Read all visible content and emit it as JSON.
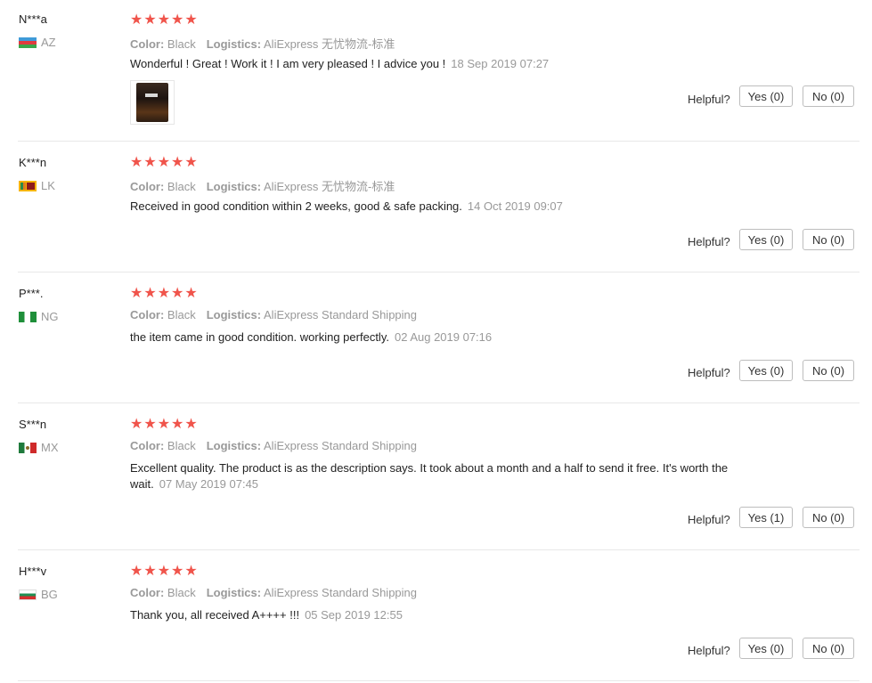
{
  "colors": {
    "star": "#f0544b",
    "muted": "#999999",
    "text": "#222222"
  },
  "labels": {
    "color": "Color:",
    "logistics": "Logistics:",
    "helpful": "Helpful?"
  },
  "reviews": [
    {
      "user": "N***a",
      "country": "AZ",
      "flag": "az-flag-icon",
      "stars": "★★★★★",
      "color": "Black",
      "logistics": "AliExpress 无忧物流-标准",
      "text": "Wonderful ! Great ! Work it ! I am very pleased ! I advice you !",
      "date": "18 Sep 2019 07:27",
      "yes": "Yes (0)",
      "no": "No (0)",
      "has_photo": true
    },
    {
      "user": "K***n",
      "country": "LK",
      "flag": "lk-flag-icon",
      "stars": "★★★★★",
      "color": "Black",
      "logistics": "AliExpress 无忧物流-标准",
      "text": "Received in good condition within 2 weeks, good & safe packing.",
      "date": "14 Oct 2019 09:07",
      "yes": "Yes (0)",
      "no": "No (0)"
    },
    {
      "user": "P***.",
      "country": "NG",
      "flag": "ng-flag-icon",
      "stars": "★★★★★",
      "color": "Black",
      "logistics": "AliExpress Standard Shipping",
      "text": "the item came in good condition. working perfectly.",
      "date": "02 Aug 2019 07:16",
      "yes": "Yes (0)",
      "no": "No (0)"
    },
    {
      "user": "S***n",
      "country": "MX",
      "flag": "mx-flag-icon",
      "stars": "★★★★★",
      "color": "Black",
      "logistics": "AliExpress Standard Shipping",
      "text": "Excellent quality. The product is as the description says. It took about a month and a half to send it free. It's worth the wait.",
      "date": "07 May 2019 07:45",
      "yes": "Yes (1)",
      "no": "No (0)"
    },
    {
      "user": "H***v",
      "country": "BG",
      "flag": "bg-flag-icon",
      "stars": "★★★★★",
      "color": "Black",
      "logistics": "AliExpress Standard Shipping",
      "text": "Thank you, all received A++++ !!!",
      "date": "05 Sep 2019 12:55",
      "yes": "Yes (0)",
      "no": "No (0)"
    }
  ]
}
